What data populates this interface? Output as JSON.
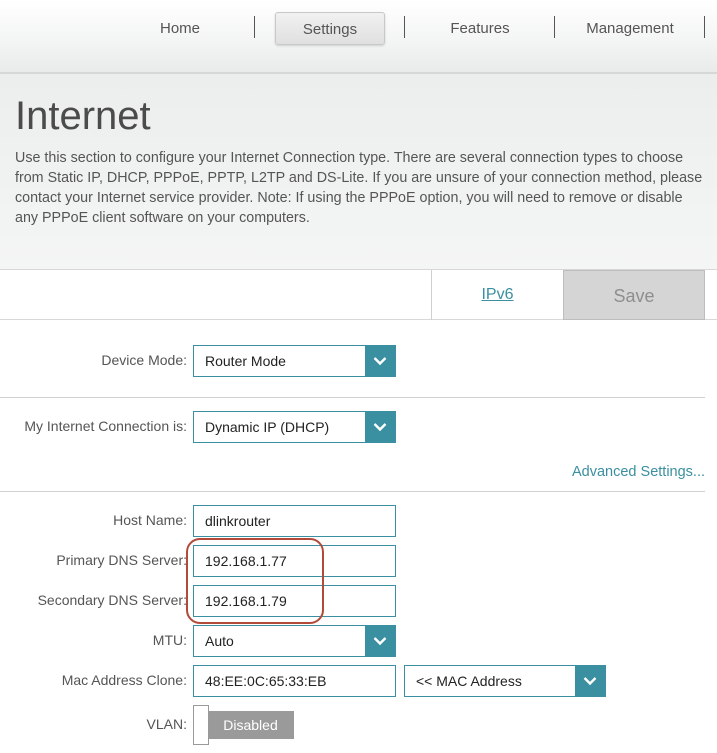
{
  "nav": {
    "items": [
      {
        "label": "Home",
        "active": false
      },
      {
        "label": "Settings",
        "active": true
      },
      {
        "label": "Features",
        "active": false
      },
      {
        "label": "Management",
        "active": false
      }
    ]
  },
  "header": {
    "title": "Internet",
    "description": "Use this section to configure your Internet Connection type. There are several connection types to choose from Static IP, DHCP, PPPoE, PPTP, L2TP and DS-Lite. If you are unsure of your connection method, please contact your Internet service provider. Note: If using the PPPoE option, you will need to remove or disable any PPPoE client software on your computers."
  },
  "actions": {
    "ipv6_label": "IPv6",
    "save_label": "Save"
  },
  "form": {
    "device_mode": {
      "label": "Device Mode:",
      "value": "Router Mode"
    },
    "connection": {
      "label": "My Internet Connection is:",
      "value": "Dynamic IP (DHCP)"
    },
    "advanced_link": "Advanced Settings...",
    "host_name": {
      "label": "Host Name:",
      "value": "dlinkrouter"
    },
    "primary_dns": {
      "label": "Primary DNS Server:",
      "value": "192.168.1.77"
    },
    "secondary_dns": {
      "label": "Secondary DNS Server:",
      "value": "192.168.1.79"
    },
    "mtu": {
      "label": "MTU:",
      "value": "Auto"
    },
    "mac_clone": {
      "label": "Mac Address Clone:",
      "value": "48:EE:0C:65:33:EB",
      "select_value": "<< MAC Address"
    },
    "vlan": {
      "label": "VLAN:",
      "state": "Disabled"
    }
  },
  "colors": {
    "accent": "#3a8fa0",
    "highlight_ring": "#b24a3a",
    "save_bg": "#d5d5d5",
    "toggle_bg": "#9a9a9a"
  }
}
